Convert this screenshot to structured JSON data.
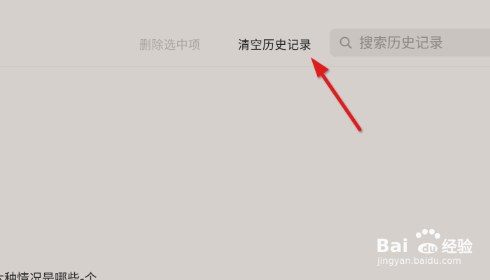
{
  "toolbar": {
    "delete_selected_label": "删除选中项",
    "clear_history_label": "清空历史记录"
  },
  "search": {
    "placeholder": "搜索历史记录",
    "value": ""
  },
  "content": {
    "partial_text": "六种情况是哪些-个"
  },
  "watermark": {
    "brand": "Bai经验",
    "url": "jingyan.baidu.com"
  },
  "annotation": {
    "arrow_color": "#e01b1b",
    "arrow_icon": "red-arrow-icon"
  },
  "colors": {
    "background": "#d5d0cc",
    "search_bg": "#c9c4c0",
    "disabled_text": "#a9a4a0",
    "active_text": "#1f1f1f"
  }
}
